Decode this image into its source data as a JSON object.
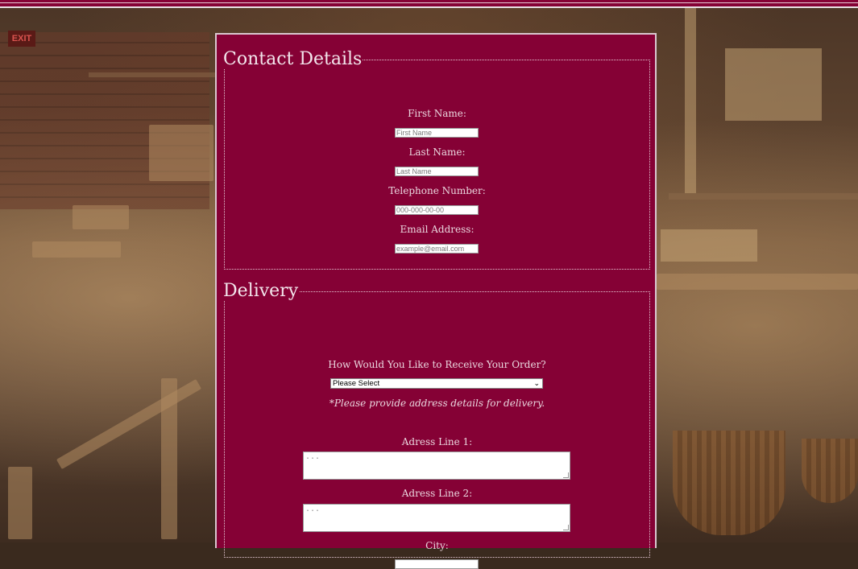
{
  "background": {
    "exit_sign": "EXIT"
  },
  "contact": {
    "legend": "Contact Details",
    "fields": [
      {
        "label": "First Name:",
        "placeholder": "First Name"
      },
      {
        "label": "Last Name:",
        "placeholder": "Last Name"
      },
      {
        "label": "Telephone Number:",
        "placeholder": "000-000-00-00"
      },
      {
        "label": "Email Address:",
        "placeholder": "example@email.com"
      }
    ]
  },
  "delivery": {
    "legend": "Delivery",
    "question": "How Would You Like to Receive Your Order?",
    "select_value": "Please Select",
    "note": "*Please provide address details for delivery.",
    "address1_label": "Adress Line 1:",
    "address1_placeholder": "...",
    "address2_label": "Adress Line 2:",
    "address2_placeholder": "...",
    "city_label": "City:"
  },
  "colors": {
    "panel": "#850135",
    "text": "#ead6de"
  }
}
